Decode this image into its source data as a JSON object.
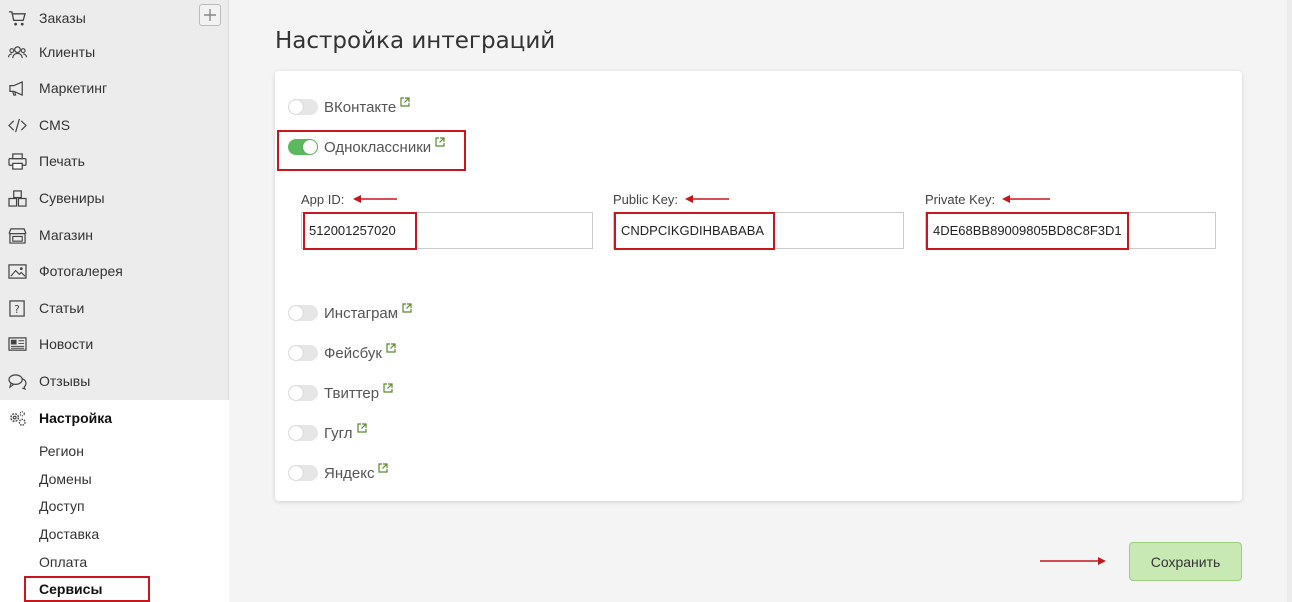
{
  "sidebar": {
    "items": [
      {
        "label": "Заказы",
        "icon": "cart-icon"
      },
      {
        "label": "Клиенты",
        "icon": "users-icon"
      },
      {
        "label": "Маркетинг",
        "icon": "megaphone-icon"
      },
      {
        "label": "CMS",
        "icon": "code-icon"
      },
      {
        "label": "Печать",
        "icon": "printer-icon"
      },
      {
        "label": "Сувениры",
        "icon": "boxes-icon"
      },
      {
        "label": "Магазин",
        "icon": "shop-icon"
      },
      {
        "label": "Фотогалерея",
        "icon": "image-icon"
      },
      {
        "label": "Статьи",
        "icon": "question-icon"
      },
      {
        "label": "Новости",
        "icon": "newspaper-icon"
      },
      {
        "label": "Отзывы",
        "icon": "comments-icon"
      },
      {
        "label": "Настройка",
        "icon": "gears-icon"
      }
    ],
    "sub_items": [
      "Регион",
      "Домены",
      "Доступ",
      "Доставка",
      "Оплата",
      "Сервисы"
    ],
    "add_button": "+"
  },
  "main": {
    "title": "Настройка интеграций",
    "integrations": [
      {
        "label": "ВКонтакте",
        "enabled": false
      },
      {
        "label": "Одноклассники",
        "enabled": true
      },
      {
        "label": "Инстаграм",
        "enabled": false
      },
      {
        "label": "Фейсбук",
        "enabled": false
      },
      {
        "label": "Твиттер",
        "enabled": false
      },
      {
        "label": "Гугл",
        "enabled": false
      },
      {
        "label": "Яндекс",
        "enabled": false
      }
    ],
    "fields": {
      "app_id": {
        "label": "App ID:",
        "value": "512001257020"
      },
      "public_key": {
        "label": "Public Key:",
        "value": "CNDPCIKGDIHBABABA"
      },
      "private_key": {
        "label": "Private Key:",
        "value": "4DE68BB89009805BD8C8F3D1"
      }
    },
    "save_label": "Сохранить"
  },
  "colors": {
    "toggle_on": "#5cb85c",
    "annotation_red": "#c8161d",
    "save_button": "#c9e9b4",
    "link_icon": "#5b8a2c"
  }
}
